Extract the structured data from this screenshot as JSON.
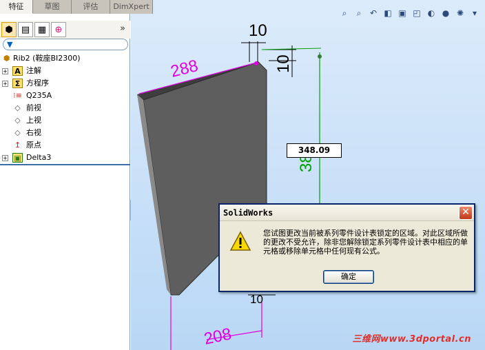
{
  "tabs": [
    {
      "label": "特征",
      "active": true
    },
    {
      "label": "草图",
      "active": false
    },
    {
      "label": "评估",
      "active": false
    },
    {
      "label": "DimXpert",
      "active": false
    }
  ],
  "filter_icon": "filter-icon",
  "tree": {
    "root": {
      "label": "Rib2  (鞍座BI2300)",
      "icon": "part-icon"
    },
    "items": [
      {
        "label": "注解",
        "icon": "annotations-icon",
        "expandable": true
      },
      {
        "label": "方程序",
        "icon": "equations-icon",
        "expandable": true
      },
      {
        "label": "Q235A",
        "icon": "material-icon",
        "expandable": false
      },
      {
        "label": "前视",
        "icon": "plane-icon",
        "expandable": false
      },
      {
        "label": "上视",
        "icon": "plane-icon",
        "expandable": false
      },
      {
        "label": "右视",
        "icon": "plane-icon",
        "expandable": false
      },
      {
        "label": "原点",
        "icon": "origin-icon",
        "expandable": false
      },
      {
        "label": "Delta3",
        "icon": "feature-icon",
        "expandable": true
      }
    ]
  },
  "dimensions": {
    "top": "288",
    "thickness": "10",
    "chamfer": "10",
    "height_partial": "38",
    "bottom": "208",
    "bottom_small": "10",
    "edit_value": "348.09"
  },
  "dialog": {
    "title": "SolidWorks",
    "message": "您试图更改当前被系列零件设计表锁定的区域。对此区域所做的更改不受允许，除非您解除锁定系列零件设计表中相应的单元格或移除单元格中任何现有公式。",
    "ok_label": "确定"
  },
  "watermark": "三维网www.3dportal.cn",
  "colors": {
    "dimension": "#e000e0",
    "driven": "#00a000",
    "part_face": "#5e5e5e",
    "dialog_border": "#0a246a"
  }
}
